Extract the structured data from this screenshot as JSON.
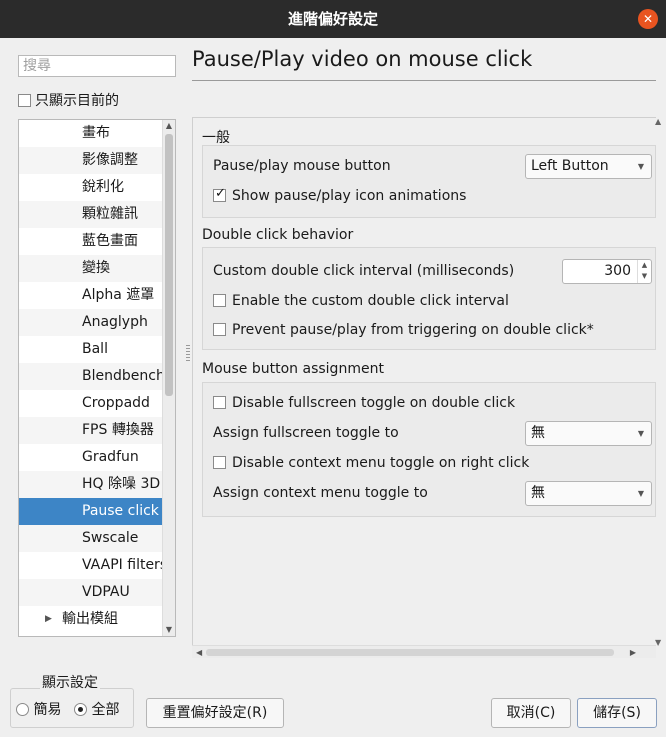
{
  "window": {
    "title": "進階偏好設定",
    "close_glyph": "✕"
  },
  "sidebar": {
    "search_placeholder": "搜尋",
    "only_current_label": "只顯示目前的",
    "only_current_checked": false,
    "items": [
      {
        "label": "畫布"
      },
      {
        "label": "影像調整"
      },
      {
        "label": "銳利化"
      },
      {
        "label": "顆粒雜訊"
      },
      {
        "label": "藍色畫面"
      },
      {
        "label": "變換"
      },
      {
        "label": "Alpha 遮罩"
      },
      {
        "label": "Anaglyph"
      },
      {
        "label": "Ball"
      },
      {
        "label": "Blendbench"
      },
      {
        "label": "Croppadd"
      },
      {
        "label": "FPS 轉換器"
      },
      {
        "label": "Gradfun"
      },
      {
        "label": "HQ 除噪 3D"
      },
      {
        "label": "Pause click",
        "selected": true
      },
      {
        "label": "Swscale"
      },
      {
        "label": "VAAPI filters"
      },
      {
        "label": "VDPAU"
      },
      {
        "label": "輸出模組",
        "has_children": true
      }
    ]
  },
  "main": {
    "title": "Pause/Play video on mouse click",
    "sections": {
      "general": {
        "header": "一般",
        "mouse_button_label": "Pause/play mouse button",
        "mouse_button_value": "Left Button",
        "show_icon_label": "Show pause/play icon animations",
        "show_icon_checked": true
      },
      "double_click": {
        "header": "Double click behavior",
        "interval_label": "Custom double click interval (milliseconds)",
        "interval_value": "300",
        "enable_custom_label": "Enable the custom double click interval",
        "enable_custom_checked": false,
        "prevent_label": "Prevent pause/play from triggering on double click*",
        "prevent_checked": false
      },
      "mouse_assignment": {
        "header": "Mouse button assignment",
        "disable_fullscreen_label": "Disable fullscreen toggle on double click",
        "disable_fullscreen_checked": false,
        "assign_fullscreen_label": "Assign fullscreen toggle to",
        "assign_fullscreen_value": "無",
        "disable_context_label": "Disable context menu toggle on right click",
        "disable_context_checked": false,
        "assign_context_label": "Assign context menu toggle to",
        "assign_context_value": "無"
      }
    }
  },
  "footer": {
    "display_settings_label": "顯示設定",
    "simple_label": "簡易",
    "all_label": "全部",
    "selected_mode": "all",
    "reset_button": "重置偏好設定(R)",
    "cancel_button": "取消(C)",
    "save_button": "儲存(S)"
  },
  "colors": {
    "titlebar": "#2b2b2b",
    "close": "#e95420",
    "selection": "#3d85c6"
  }
}
